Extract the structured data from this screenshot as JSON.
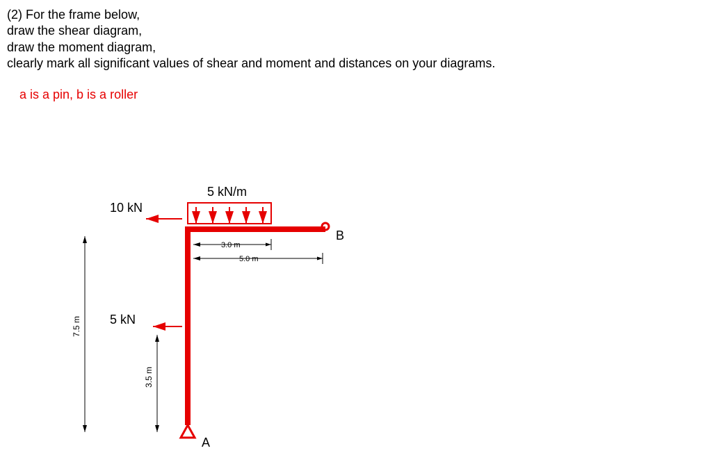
{
  "problem": {
    "line1": "(2) For the frame below,",
    "line2": "draw the shear diagram,",
    "line3": "draw the moment diagram,",
    "line4": "clearly mark all significant values of shear and moment and distances on your diagrams."
  },
  "note": "a is a pin, b is a roller",
  "labels": {
    "dist_load": "5 kN/m",
    "force_top": "10 kN",
    "force_mid": "5 kN",
    "pointA": "A",
    "pointB": "B",
    "h_total": "7.5 m",
    "h_mid": "3.5 m",
    "span_load": "3.0 m",
    "span_full": "5.0 m"
  },
  "chart_data": {
    "type": "frame-diagram",
    "supports": {
      "A": {
        "type": "pin",
        "location": "base of column"
      },
      "B": {
        "type": "roller",
        "location": "end of beam"
      }
    },
    "geometry": {
      "column_height_m": 7.5,
      "mid_force_height_from_base_m": 3.5,
      "beam_span_m": 5.0,
      "distributed_load_extent_m": 3.0
    },
    "loads": {
      "horizontal_point_top_kN": 10,
      "horizontal_point_mid_kN": 5,
      "distributed_vertical_kN_per_m": 5
    }
  }
}
